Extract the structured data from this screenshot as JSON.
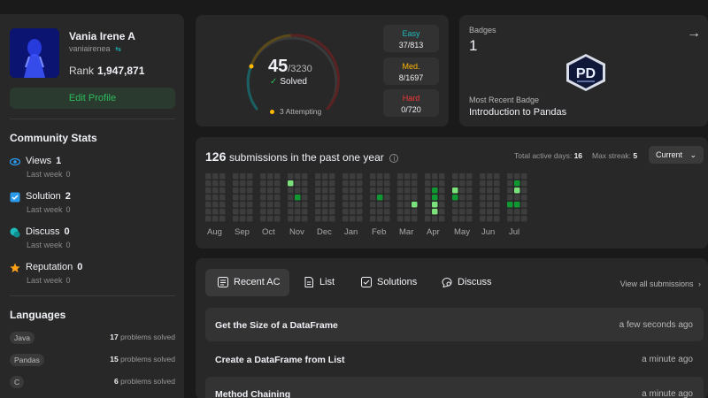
{
  "profile": {
    "name": "Vania Irene A",
    "username": "vaniairenea",
    "rank_label": "Rank",
    "rank_value": "1,947,871",
    "edit_label": "Edit Profile"
  },
  "community": {
    "title": "Community Stats",
    "stats": [
      {
        "label": "Views",
        "value": "1",
        "sub_label": "Last week",
        "sub_value": "0",
        "icon": "eye-icon"
      },
      {
        "label": "Solution",
        "value": "2",
        "sub_label": "Last week",
        "sub_value": "0",
        "icon": "check-square-icon"
      },
      {
        "label": "Discuss",
        "value": "0",
        "sub_label": "Last week",
        "sub_value": "0",
        "icon": "discuss-icon"
      },
      {
        "label": "Reputation",
        "value": "0",
        "sub_label": "Last week",
        "sub_value": "0",
        "icon": "star-icon"
      }
    ]
  },
  "languages": {
    "title": "Languages",
    "items": [
      {
        "name": "Java",
        "count": "17",
        "suffix": "problems solved"
      },
      {
        "name": "Pandas",
        "count": "15",
        "suffix": "problems solved"
      },
      {
        "name": "C",
        "count": "6",
        "suffix": "problems solved"
      }
    ]
  },
  "solved": {
    "count": "45",
    "total": "/3230",
    "label": "Solved",
    "attempting": "3 Attempting",
    "difficulties": [
      {
        "name": "Easy",
        "value": "37/813",
        "color": "#1cbaba"
      },
      {
        "name": "Med.",
        "value": "8/1697",
        "color": "#ffb700"
      },
      {
        "name": "Hard",
        "value": "0/720",
        "color": "#f63737"
      }
    ]
  },
  "badges": {
    "label": "Badges",
    "count": "1",
    "recent_label": "Most Recent Badge",
    "recent_name": "Introduction to Pandas",
    "badge_text": "PD"
  },
  "heatmap": {
    "count": "126",
    "title_suffix": "submissions in the past one year",
    "active_label": "Total active days:",
    "active_value": "16",
    "streak_label": "Max streak:",
    "streak_value": "5",
    "selector": "Current",
    "months": [
      "Aug",
      "Sep",
      "Oct",
      "Nov",
      "Dec",
      "Jan",
      "Feb",
      "Mar",
      "Apr",
      "May",
      "Jun",
      "Jul"
    ],
    "active_cells": [
      {
        "month": "Nov",
        "week": 0,
        "day": 1,
        "level": 2
      },
      {
        "month": "Nov",
        "week": 1,
        "day": 3,
        "level": 1
      },
      {
        "month": "Feb",
        "week": 1,
        "day": 3,
        "level": 1
      },
      {
        "month": "Mar",
        "week": 2,
        "day": 4,
        "level": 2
      },
      {
        "month": "Apr",
        "week": 1,
        "day": 2,
        "level": 1
      },
      {
        "month": "Apr",
        "week": 1,
        "day": 3,
        "level": 1
      },
      {
        "month": "Apr",
        "week": 1,
        "day": 4,
        "level": 2
      },
      {
        "month": "Apr",
        "week": 1,
        "day": 5,
        "level": 2
      },
      {
        "month": "May",
        "week": 0,
        "day": 2,
        "level": 2
      },
      {
        "month": "May",
        "week": 0,
        "day": 3,
        "level": 1
      },
      {
        "month": "Jul",
        "week": 1,
        "day": 1,
        "level": 1
      },
      {
        "month": "Jul",
        "week": 1,
        "day": 2,
        "level": 2
      },
      {
        "month": "Jul",
        "week": 1,
        "day": 4,
        "level": 1
      },
      {
        "month": "Jul",
        "week": 0,
        "day": 4,
        "level": 1
      }
    ],
    "colors": {
      "empty": "#3d3d3d",
      "level1": "#109932",
      "level2": "#7be27b"
    }
  },
  "tabs": {
    "items": [
      {
        "label": "Recent AC",
        "icon": "list-check-icon"
      },
      {
        "label": "List",
        "icon": "document-icon"
      },
      {
        "label": "Solutions",
        "icon": "check-box-icon"
      },
      {
        "label": "Discuss",
        "icon": "chat-search-icon"
      }
    ],
    "view_all": "View all submissions"
  },
  "submissions": [
    {
      "title": "Get the Size of a DataFrame",
      "time": "a few seconds ago"
    },
    {
      "title": "Create a DataFrame from List",
      "time": "a minute ago"
    },
    {
      "title": "Method Chaining",
      "time": "a minute ago"
    }
  ]
}
